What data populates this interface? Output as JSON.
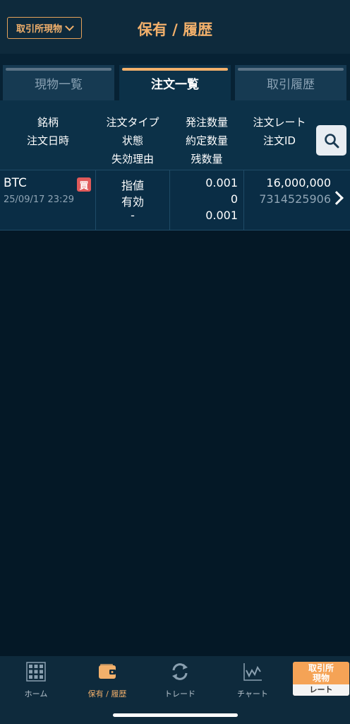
{
  "header": {
    "market_selector": "取引所現物",
    "title": "保有 / 履歴"
  },
  "tabs": [
    {
      "label": "現物一覧",
      "active": false
    },
    {
      "label": "注文一覧",
      "active": true
    },
    {
      "label": "取引履歴",
      "active": false
    }
  ],
  "columns": {
    "col1": [
      "銘柄",
      "注文日時"
    ],
    "col2": [
      "注文タイプ",
      "状態",
      "失効理由"
    ],
    "col3": [
      "発注数量",
      "約定数量",
      "残数量"
    ],
    "col4": [
      "注文レート",
      "注文ID"
    ]
  },
  "orders": [
    {
      "symbol": "BTC",
      "side": "買",
      "datetime": "25/09/17 23:29",
      "order_type": "指値",
      "status": "有効",
      "expire_reason": "-",
      "order_qty": "0.001",
      "filled_qty": "0",
      "remaining_qty": "0.001",
      "rate": "16,000,000",
      "order_id": "7314525906"
    }
  ],
  "nav": {
    "home": "ホーム",
    "holdings": "保有 / 履歴",
    "trade": "トレード",
    "chart": "チャート",
    "rate_top_1": "取引所",
    "rate_top_2": "現物",
    "rate_bottom": "レート"
  },
  "colors": {
    "accent": "#f2b06b",
    "background": "#041826",
    "buy_badge": "#e05a5a"
  }
}
